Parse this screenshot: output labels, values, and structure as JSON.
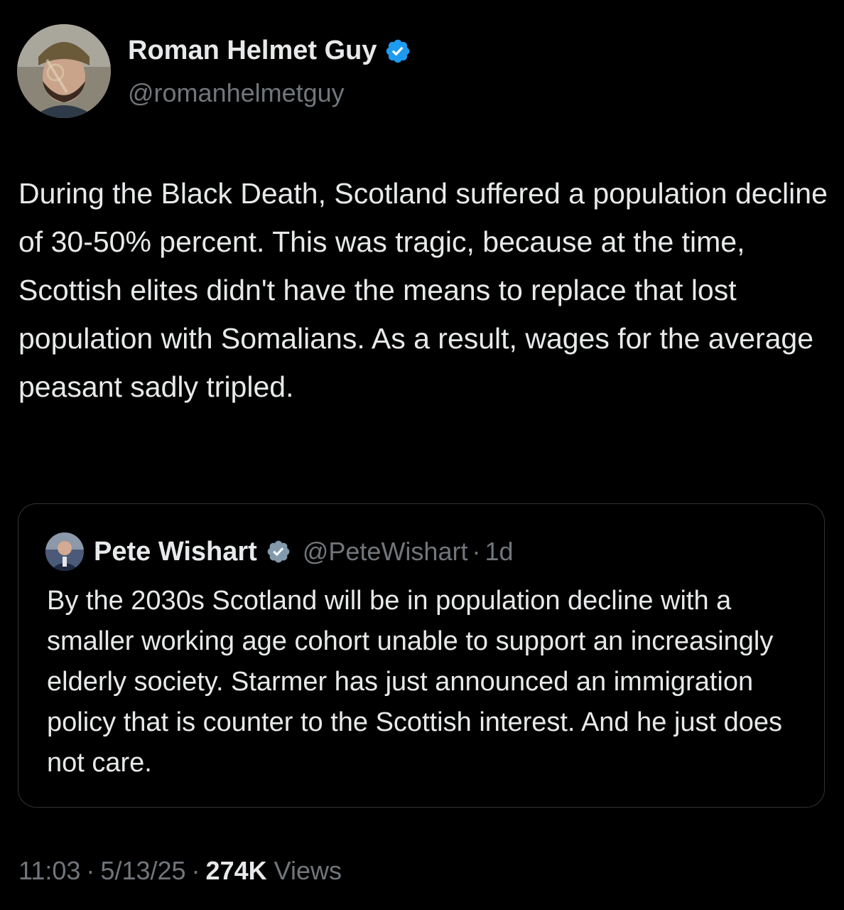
{
  "tweet": {
    "author": {
      "name": "Roman Helmet Guy",
      "handle": "@romanhelmetguy",
      "verified_color": "#1d9bf0"
    },
    "text": "During the Black Death, Scotland suffered a population decline of 30-50% percent. This was tragic, because at the time, Scottish elites didn't have the means to replace that lost population with Somalians. As a result, wages for the average peasant sadly tripled.",
    "quoted": {
      "name": "Pete Wishart",
      "handle": "@PeteWishart",
      "separator": "·",
      "time": "1d",
      "verified_color": "#829aab",
      "text": "By the 2030s Scotland will be in population decline with a smaller working age cohort unable to support an increasingly elderly society. Starmer has just announced an immigration policy that is counter to the Scottish interest. And he just does not care."
    },
    "meta": {
      "time": "11:03",
      "separator": "·",
      "date": "5/13/25",
      "views_count": "274K",
      "views_label": "Views"
    }
  }
}
